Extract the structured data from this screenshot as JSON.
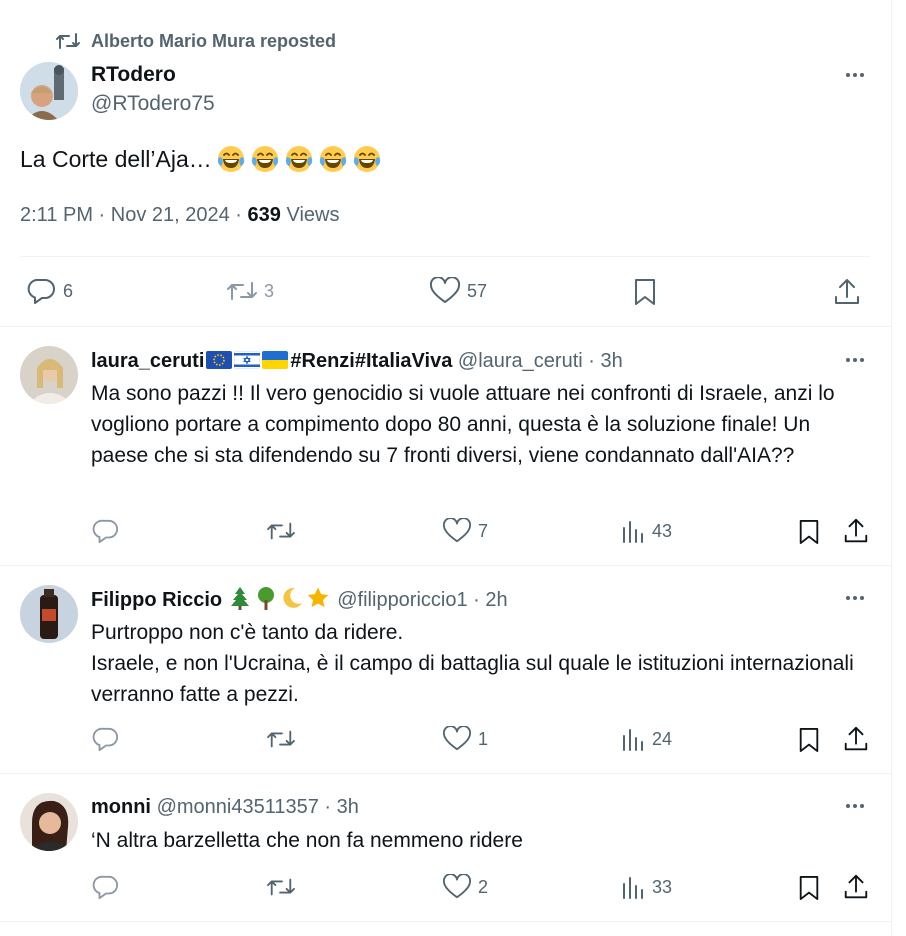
{
  "repost_banner": {
    "text": "Alberto Mario Mura reposted"
  },
  "main_tweet": {
    "display_name": "RTodero",
    "handle": "@RTodero75",
    "text": "La Corte dell’Aja…",
    "emoji_count": 5,
    "time": "2:11 PM · Nov 21, 2024 · ",
    "views_count": "639",
    "views_label": " Views",
    "stats": {
      "replies": "6",
      "reposts": "3",
      "likes": "57"
    }
  },
  "replies": [
    {
      "display_name": "laura_ceruti",
      "name_suffix": "#Renzi#ItaliaViva",
      "handle_time": "@laura_ceruti · 3h",
      "text": "Ma sono pazzi !! Il vero genocidio si vuole attuare nei confronti di Israele, anzi lo vogliono portare a compimento dopo 80 anni, questa è la soluzione finale! Un paese che si sta difendendo su 7 fronti diversi, viene condannato dall'AIA??",
      "likes": "7",
      "views": "43"
    },
    {
      "display_name": "Filippo Riccio",
      "handle_time": "@filipporiccio1 · 2h",
      "text_line1": "Purtroppo non c'è tanto da ridere.",
      "text_line2": "Israele, e non l'Ucraina, è il campo di battaglia sul quale le istituzioni internazionali verranno fatte a pezzi.",
      "likes": "1",
      "views": "24"
    },
    {
      "display_name": "monni",
      "handle_time": "@monni43511357 · 3h",
      "text": "‘N altra barzelletta che non fa nemmeno ridere",
      "likes": "2",
      "views": "33"
    }
  ],
  "colors": {
    "text": "#0f1419",
    "secondary": "#536471",
    "divider": "#eff3f4"
  }
}
